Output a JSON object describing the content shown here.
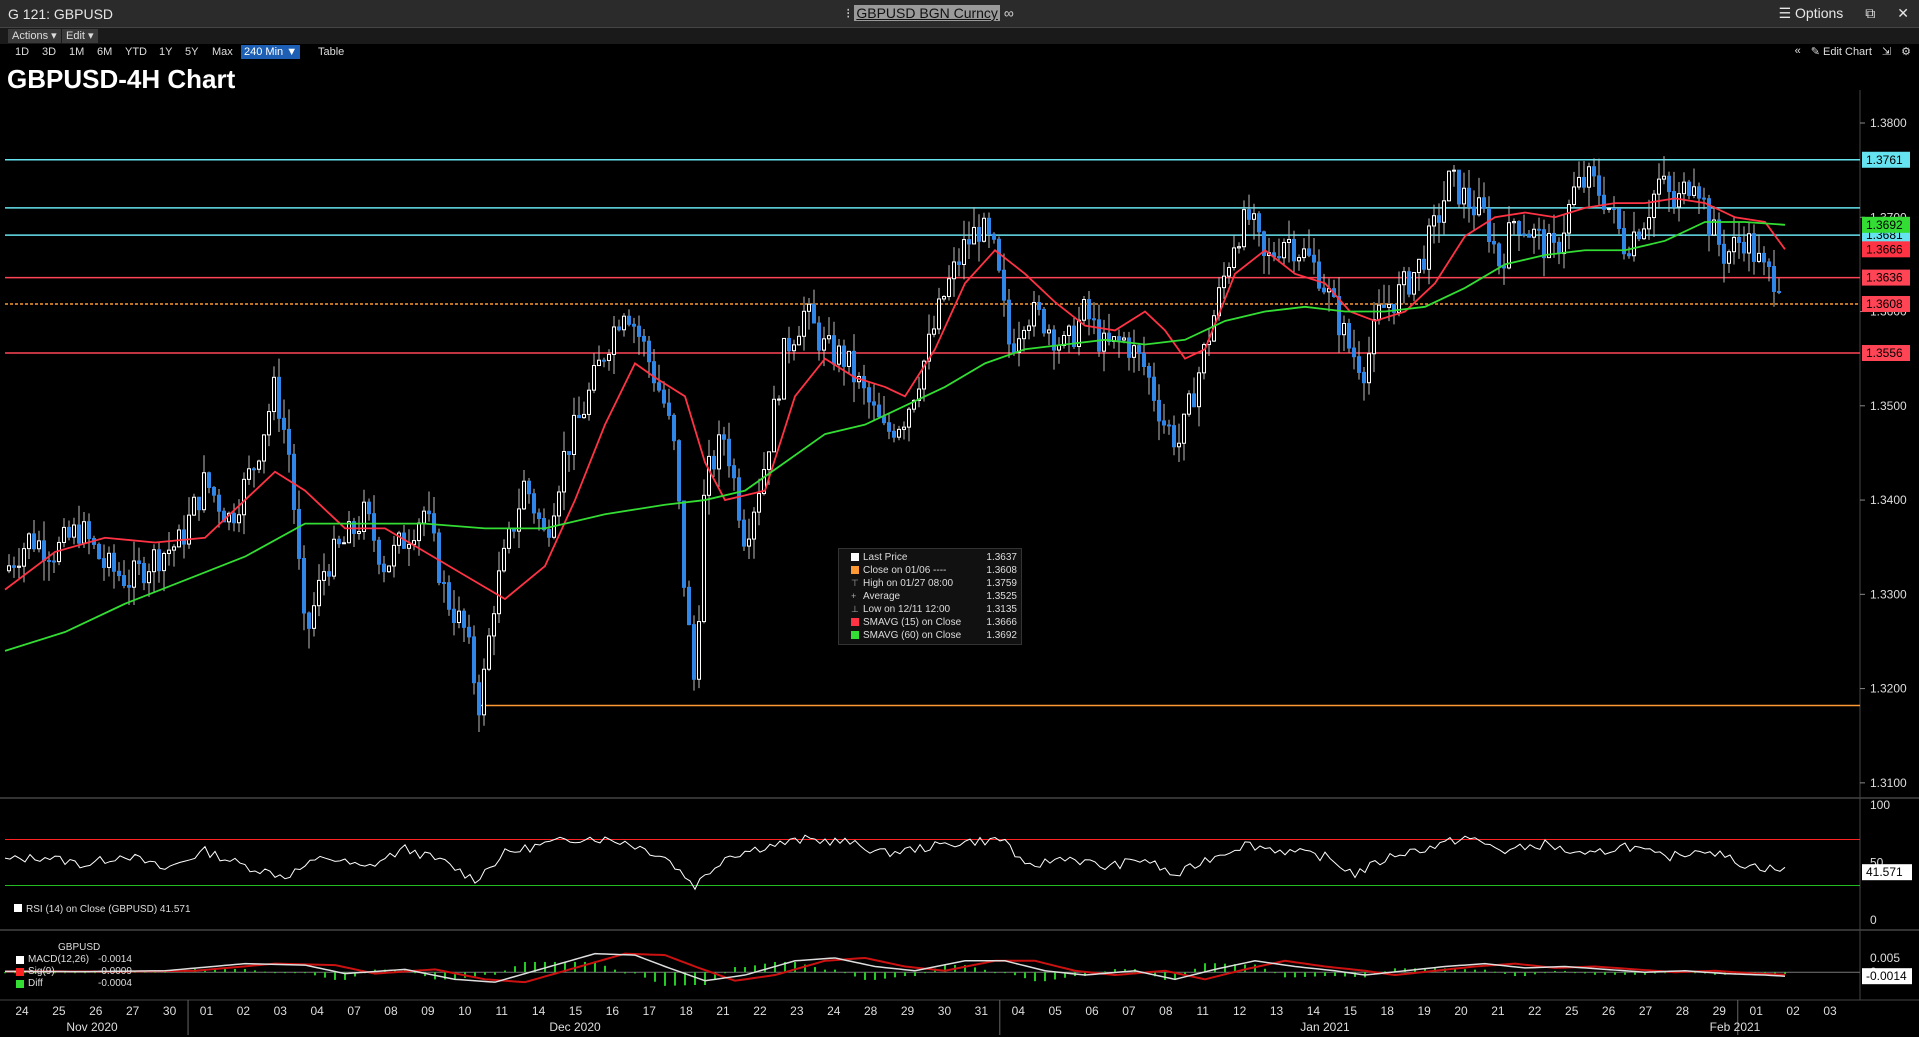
{
  "window": {
    "left_title": "G 121: GBPUSD",
    "security": "GBPUSD BGN Curncy",
    "options_label": "Options"
  },
  "menu": {
    "actions": "Actions ▾",
    "edit": "Edit ▾"
  },
  "toolbar": {
    "ranges": [
      "1D",
      "3D",
      "1M",
      "6M",
      "YTD",
      "1Y",
      "5Y",
      "Max"
    ],
    "interval": "240 Min ▼",
    "table": "Table",
    "edit_chart": "Edit Chart"
  },
  "colors": {
    "up": "#ffffff",
    "down": "#2f86e6",
    "sma15": "#ff3344",
    "sma60": "#33dd33",
    "cyan": "#66e3f0",
    "red": "#ff4455",
    "orange": "#ff9933",
    "bg": "#000000"
  },
  "chart_data": {
    "type": "line",
    "title": "GBPUSD-4H Chart",
    "ylim": [
      1.3085,
      1.3835
    ],
    "y_ticks": [
      "1.3800",
      "1.3700",
      "1.3600",
      "1.3500",
      "1.3400",
      "1.3300",
      "1.3200",
      "1.3100"
    ],
    "x_ticks": [
      "24",
      "25",
      "26",
      "27",
      "30",
      "01",
      "02",
      "03",
      "04",
      "07",
      "08",
      "09",
      "10",
      "11",
      "14",
      "15",
      "16",
      "17",
      "18",
      "21",
      "22",
      "23",
      "24",
      "28",
      "29",
      "30",
      "31",
      "04",
      "05",
      "06",
      "07",
      "08",
      "11",
      "12",
      "13",
      "14",
      "15",
      "18",
      "19",
      "20",
      "21",
      "22",
      "25",
      "26",
      "27",
      "28",
      "29",
      "01",
      "02",
      "03"
    ],
    "x_months": [
      "Nov 2020",
      "Dec 2020",
      "Jan 2021",
      "Feb 2021"
    ],
    "price_path": [
      [
        0,
        1.3325
      ],
      [
        25,
        1.336
      ],
      [
        50,
        1.3345
      ],
      [
        75,
        1.337
      ],
      [
        100,
        1.333
      ],
      [
        125,
        1.3315
      ],
      [
        150,
        1.334
      ],
      [
        175,
        1.3355
      ],
      [
        200,
        1.342
      ],
      [
        225,
        1.338
      ],
      [
        250,
        1.344
      ],
      [
        270,
        1.352
      ],
      [
        285,
        1.3445
      ],
      [
        300,
        1.325
      ],
      [
        320,
        1.333
      ],
      [
        340,
        1.3355
      ],
      [
        360,
        1.3385
      ],
      [
        380,
        1.333
      ],
      [
        400,
        1.336
      ],
      [
        420,
        1.339
      ],
      [
        440,
        1.33
      ],
      [
        460,
        1.326
      ],
      [
        475,
        1.318
      ],
      [
        490,
        1.33
      ],
      [
        505,
        1.336
      ],
      [
        520,
        1.342
      ],
      [
        540,
        1.336
      ],
      [
        560,
        1.345
      ],
      [
        580,
        1.35
      ],
      [
        600,
        1.356
      ],
      [
        620,
        1.361
      ],
      [
        640,
        1.356
      ],
      [
        660,
        1.35
      ],
      [
        670,
        1.345
      ],
      [
        680,
        1.33
      ],
      [
        690,
        1.32
      ],
      [
        700,
        1.342
      ],
      [
        720,
        1.347
      ],
      [
        740,
        1.336
      ],
      [
        760,
        1.344
      ],
      [
        780,
        1.356
      ],
      [
        800,
        1.36
      ],
      [
        820,
        1.356
      ],
      [
        840,
        1.355
      ],
      [
        860,
        1.351
      ],
      [
        880,
        1.347
      ],
      [
        900,
        1.349
      ],
      [
        920,
        1.355
      ],
      [
        940,
        1.362
      ],
      [
        960,
        1.367
      ],
      [
        975,
        1.369
      ],
      [
        990,
        1.366
      ],
      [
        1005,
        1.356
      ],
      [
        1020,
        1.36
      ],
      [
        1040,
        1.359
      ],
      [
        1060,
        1.356
      ],
      [
        1080,
        1.36
      ],
      [
        1100,
        1.356
      ],
      [
        1120,
        1.357
      ],
      [
        1140,
        1.354
      ],
      [
        1160,
        1.348
      ],
      [
        1175,
        1.346
      ],
      [
        1190,
        1.352
      ],
      [
        1210,
        1.36
      ],
      [
        1230,
        1.368
      ],
      [
        1245,
        1.37
      ],
      [
        1260,
        1.365
      ],
      [
        1280,
        1.368
      ],
      [
        1300,
        1.366
      ],
      [
        1315,
        1.364
      ],
      [
        1330,
        1.36
      ],
      [
        1345,
        1.356
      ],
      [
        1360,
        1.354
      ],
      [
        1375,
        1.36
      ],
      [
        1395,
        1.362
      ],
      [
        1415,
        1.365
      ],
      [
        1430,
        1.369
      ],
      [
        1445,
        1.374
      ],
      [
        1460,
        1.372
      ],
      [
        1480,
        1.37
      ],
      [
        1495,
        1.365
      ],
      [
        1510,
        1.37
      ],
      [
        1530,
        1.368
      ],
      [
        1550,
        1.366
      ],
      [
        1570,
        1.373
      ],
      [
        1585,
        1.374
      ],
      [
        1600,
        1.372
      ],
      [
        1620,
        1.367
      ],
      [
        1640,
        1.37
      ],
      [
        1655,
        1.374
      ],
      [
        1670,
        1.371
      ],
      [
        1690,
        1.375
      ],
      [
        1705,
        1.369
      ],
      [
        1720,
        1.366
      ],
      [
        1740,
        1.368
      ],
      [
        1760,
        1.364
      ],
      [
        1775,
        1.3637
      ]
    ],
    "series": [
      {
        "name": "SMAVG (15) on Close",
        "path": [
          [
            0,
            1.3305
          ],
          [
            50,
            1.3345
          ],
          [
            100,
            1.336
          ],
          [
            150,
            1.3355
          ],
          [
            200,
            1.336
          ],
          [
            240,
            1.34
          ],
          [
            270,
            1.343
          ],
          [
            300,
            1.341
          ],
          [
            340,
            1.337
          ],
          [
            380,
            1.337
          ],
          [
            420,
            1.3345
          ],
          [
            460,
            1.332
          ],
          [
            500,
            1.3295
          ],
          [
            540,
            1.333
          ],
          [
            570,
            1.34
          ],
          [
            600,
            1.348
          ],
          [
            630,
            1.3545
          ],
          [
            650,
            1.353
          ],
          [
            680,
            1.351
          ],
          [
            700,
            1.344
          ],
          [
            720,
            1.34
          ],
          [
            740,
            1.3405
          ],
          [
            760,
            1.341
          ],
          [
            790,
            1.351
          ],
          [
            820,
            1.355
          ],
          [
            850,
            1.353
          ],
          [
            880,
            1.352
          ],
          [
            900,
            1.351
          ],
          [
            930,
            1.356
          ],
          [
            960,
            1.363
          ],
          [
            990,
            1.3665
          ],
          [
            1020,
            1.364
          ],
          [
            1050,
            1.361
          ],
          [
            1080,
            1.3585
          ],
          [
            1110,
            1.358
          ],
          [
            1140,
            1.36
          ],
          [
            1160,
            1.358
          ],
          [
            1180,
            1.355
          ],
          [
            1200,
            1.356
          ],
          [
            1230,
            1.364
          ],
          [
            1260,
            1.3665
          ],
          [
            1290,
            1.364
          ],
          [
            1320,
            1.363
          ],
          [
            1345,
            1.36
          ],
          [
            1370,
            1.359
          ],
          [
            1400,
            1.36
          ],
          [
            1430,
            1.363
          ],
          [
            1460,
            1.368
          ],
          [
            1490,
            1.37
          ],
          [
            1520,
            1.3705
          ],
          [
            1550,
            1.37
          ],
          [
            1580,
            1.371
          ],
          [
            1610,
            1.3715
          ],
          [
            1640,
            1.3715
          ],
          [
            1670,
            1.372
          ],
          [
            1700,
            1.3715
          ],
          [
            1730,
            1.37
          ],
          [
            1760,
            1.3695
          ],
          [
            1780,
            1.3666
          ]
        ]
      },
      {
        "name": "SMAVG (60) on Close",
        "path": [
          [
            0,
            1.324
          ],
          [
            60,
            1.326
          ],
          [
            120,
            1.329
          ],
          [
            180,
            1.3315
          ],
          [
            240,
            1.334
          ],
          [
            300,
            1.3375
          ],
          [
            360,
            1.3375
          ],
          [
            420,
            1.3375
          ],
          [
            480,
            1.337
          ],
          [
            540,
            1.337
          ],
          [
            600,
            1.3385
          ],
          [
            660,
            1.3395
          ],
          [
            700,
            1.34
          ],
          [
            740,
            1.341
          ],
          [
            780,
            1.344
          ],
          [
            820,
            1.347
          ],
          [
            860,
            1.348
          ],
          [
            900,
            1.35
          ],
          [
            940,
            1.352
          ],
          [
            980,
            1.3545
          ],
          [
            1020,
            1.356
          ],
          [
            1060,
            1.3565
          ],
          [
            1100,
            1.357
          ],
          [
            1140,
            1.3565
          ],
          [
            1180,
            1.357
          ],
          [
            1220,
            1.359
          ],
          [
            1260,
            1.36
          ],
          [
            1300,
            1.3605
          ],
          [
            1340,
            1.36
          ],
          [
            1380,
            1.36
          ],
          [
            1420,
            1.3605
          ],
          [
            1460,
            1.3625
          ],
          [
            1500,
            1.365
          ],
          [
            1540,
            1.366
          ],
          [
            1580,
            1.3665
          ],
          [
            1620,
            1.3665
          ],
          [
            1660,
            1.3675
          ],
          [
            1700,
            1.3695
          ],
          [
            1740,
            1.3695
          ],
          [
            1780,
            1.3692
          ]
        ]
      }
    ],
    "levels": [
      {
        "value": 1.3761,
        "label": "1.3761",
        "color": "#66e3f0",
        "fill": "#66e3f0"
      },
      {
        "value": 1.371,
        "label": "",
        "color": "#66e3f0",
        "fill": ""
      },
      {
        "value": 1.3681,
        "label": "1.3681",
        "color": "#66e3f0",
        "fill": "#66e3f0"
      },
      {
        "value": 1.3636,
        "label": "1.3636",
        "color": "#ff4455",
        "fill": "#ff4455"
      },
      {
        "value": 1.3608,
        "label": "1.3608",
        "color": "#ff9933",
        "fill": "#ff4455",
        "dashed": true
      },
      {
        "value": 1.3556,
        "label": "1.3556",
        "color": "#ff4455",
        "fill": "#ff4455"
      }
    ],
    "right_labels": [
      {
        "value": 1.3692,
        "label": "1.3692",
        "fill": "#33dd33"
      },
      {
        "value": 1.3666,
        "label": "1.3666",
        "fill": "#ff3344"
      }
    ],
    "low_line": {
      "value": 1.3182
    },
    "legend": [
      {
        "label": "Last Price",
        "value": "1.3637",
        "color": "#ffffff"
      },
      {
        "label": "Close on 01/06 ----",
        "value": "1.3608",
        "color": "#ff9933"
      },
      {
        "label": "High on 01/27 08:00",
        "value": "1.3759",
        "color": ""
      },
      {
        "label": "Average",
        "value": "1.3525",
        "color": ""
      },
      {
        "label": "Low on 12/11 12:00",
        "value": "1.3135",
        "color": ""
      },
      {
        "label": "SMAVG (15)  on Close",
        "value": "1.3666",
        "color": "#ff3344"
      },
      {
        "label": "SMAVG (60)  on Close",
        "value": "1.3692",
        "color": "#33dd33"
      }
    ],
    "rsi": {
      "label": "RSI (14)  on Close (GBPUSD) 41.571",
      "value_label": "41.571",
      "ylim": [
        0,
        100
      ],
      "ticks": [
        "100",
        "50",
        "0"
      ],
      "upper": 70,
      "lower": 30,
      "path": [
        [
          0,
          52
        ],
        [
          40,
          55
        ],
        [
          80,
          48
        ],
        [
          120,
          57
        ],
        [
          160,
          44
        ],
        [
          200,
          60
        ],
        [
          240,
          47
        ],
        [
          280,
          38
        ],
        [
          320,
          55
        ],
        [
          360,
          45
        ],
        [
          400,
          62
        ],
        [
          440,
          50
        ],
        [
          470,
          35
        ],
        [
          500,
          58
        ],
        [
          540,
          66
        ],
        [
          580,
          72
        ],
        [
          620,
          68
        ],
        [
          660,
          55
        ],
        [
          690,
          30
        ],
        [
          720,
          55
        ],
        [
          760,
          64
        ],
        [
          800,
          70
        ],
        [
          840,
          68
        ],
        [
          880,
          58
        ],
        [
          920,
          63
        ],
        [
          960,
          68
        ],
        [
          1000,
          70
        ],
        [
          1020,
          45
        ],
        [
          1060,
          55
        ],
        [
          1100,
          46
        ],
        [
          1140,
          53
        ],
        [
          1170,
          38
        ],
        [
          1200,
          52
        ],
        [
          1240,
          66
        ],
        [
          1280,
          60
        ],
        [
          1320,
          55
        ],
        [
          1350,
          40
        ],
        [
          1390,
          57
        ],
        [
          1430,
          64
        ],
        [
          1460,
          72
        ],
        [
          1500,
          60
        ],
        [
          1540,
          66
        ],
        [
          1580,
          55
        ],
        [
          1620,
          65
        ],
        [
          1660,
          54
        ],
        [
          1700,
          62
        ],
        [
          1740,
          48
        ],
        [
          1780,
          43
        ]
      ]
    },
    "macd": {
      "title": "GBPUSD",
      "items": [
        {
          "label": "MACD(12,26)",
          "value": "-0.0014",
          "color": "#ffffff"
        },
        {
          "label": "Sig(9)",
          "value": "-0.0009",
          "color": "#ff2222"
        },
        {
          "label": "Diff",
          "value": "-0.0004",
          "color": "#33dd33"
        }
      ],
      "ticks": [
        "0.005",
        "0"
      ],
      "value_label": "-0.0014",
      "ylim": [
        -0.008,
        0.012
      ],
      "path": [
        [
          0,
          0.0003
        ],
        [
          80,
          0.0002
        ],
        [
          160,
          0.0005
        ],
        [
          240,
          0.003
        ],
        [
          300,
          0.0025
        ],
        [
          340,
          -0.0005
        ],
        [
          400,
          0.001
        ],
        [
          450,
          -0.0025
        ],
        [
          490,
          -0.0035
        ],
        [
          540,
          0.0015
        ],
        [
          590,
          0.0065
        ],
        [
          630,
          0.006
        ],
        [
          660,
          0.002
        ],
        [
          700,
          -0.003
        ],
        [
          740,
          -0.001
        ],
        [
          790,
          0.004
        ],
        [
          830,
          0.005
        ],
        [
          870,
          0.002
        ],
        [
          910,
          0.0005
        ],
        [
          960,
          0.004
        ],
        [
          1000,
          0.004
        ],
        [
          1040,
          0.0005
        ],
        [
          1080,
          -0.001
        ],
        [
          1130,
          0.0005
        ],
        [
          1170,
          -0.0025
        ],
        [
          1210,
          0.001
        ],
        [
          1250,
          0.004
        ],
        [
          1290,
          0.002
        ],
        [
          1330,
          0.0005
        ],
        [
          1360,
          -0.001
        ],
        [
          1400,
          0.0005
        ],
        [
          1440,
          0.002
        ],
        [
          1480,
          0.003
        ],
        [
          1520,
          0.0015
        ],
        [
          1560,
          0.002
        ],
        [
          1600,
          0.001
        ],
        [
          1640,
          0.0
        ],
        [
          1680,
          0.0005
        ],
        [
          1720,
          -0.0005
        ],
        [
          1760,
          -0.001
        ],
        [
          1780,
          -0.0014
        ]
      ]
    }
  }
}
